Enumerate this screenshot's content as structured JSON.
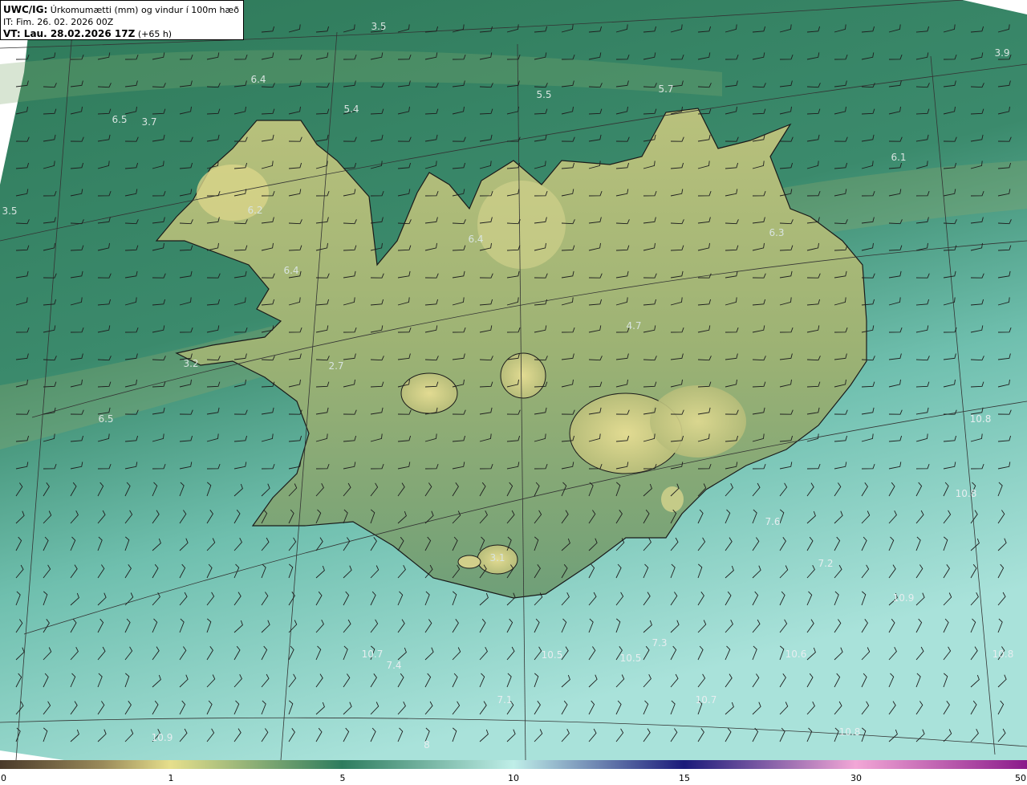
{
  "header": {
    "product": "UWC/IG:",
    "title": "Úrkomumætti (mm) og vindur í 100m hæð",
    "init_time": "IT: Fim. 26. 02. 2026 00Z",
    "valid_prefix": "VT: Lau. 28.02.2026 17Z",
    "valid_suffix": "(+65 h)"
  },
  "colorbar": {
    "ticks": [
      "0",
      "1",
      "5",
      "10",
      "15",
      "30",
      "50"
    ],
    "colors": [
      "#4a3a2a",
      "#9a8a5a",
      "#e6df8c",
      "#2e7c5e",
      "#bfeee8",
      "#1a1a7a",
      "#f2a7d6",
      "#8a1a8a"
    ]
  },
  "value_labels": [
    "3.5",
    "3.9",
    "6.4",
    "5.4",
    "5.5",
    "5.7",
    "6.5",
    "3.7",
    "6.1",
    "3.5",
    "6.2",
    "6.4",
    "6.3",
    "6.4",
    "4.7",
    "3.2",
    "2.7",
    "6.5",
    "10.8",
    "10.8",
    "7.6",
    "7.2",
    "3.1",
    "10.9",
    "10.7",
    "7.4",
    "10.5",
    "10.5",
    "7.3",
    "10.6",
    "7.1",
    "10.7",
    "10.9",
    "10.8",
    "10.8",
    "8"
  ],
  "colors": {
    "land_low": "#8fae6a",
    "land_high": "#d8d58a",
    "sea_dark": "#2d7a5c",
    "sea_light": "#a8e4dc"
  }
}
